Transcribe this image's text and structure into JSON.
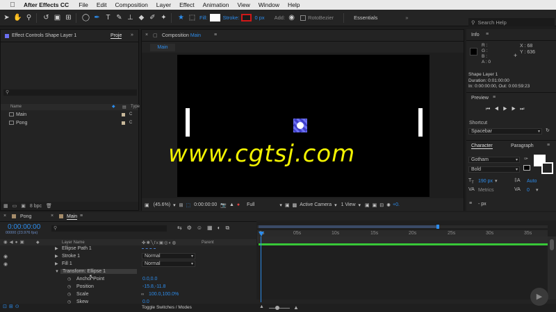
{
  "menubar": {
    "app": "After Effects CC",
    "items": [
      "File",
      "Edit",
      "Composition",
      "Layer",
      "Effect",
      "Animation",
      "View",
      "Window",
      "Help"
    ]
  },
  "toolbar": {
    "fill_label": "Fill:",
    "stroke_label": "Stroke:",
    "stroke_px": "0 px",
    "add_label": "Add:",
    "rotobezier_label": "RotoBezier",
    "workspace": "Essentials",
    "search_placeholder": "Search Help"
  },
  "project": {
    "tab_effect": "Effect Controls Shape Layer 1",
    "tab_project": "Proje",
    "col_name": "Name",
    "col_type": "Type",
    "items": [
      {
        "name": "Main",
        "type": "C"
      },
      {
        "name": "Pong",
        "type": "C"
      }
    ],
    "bpc": "8 bpc"
  },
  "composition": {
    "tab_prefix": "Composition",
    "tab_name": "Main",
    "subtab": "Main",
    "zoom": "(45.6%)",
    "timecode": "0:00:00:00",
    "resolution": "Full",
    "camera": "Active Camera",
    "view": "1 View",
    "exposure": "+0."
  },
  "info": {
    "title": "Info",
    "r": "R :",
    "g": "G :",
    "b": "B :",
    "a": "A : 0",
    "x": "X : 68",
    "y": "Y : 636",
    "layer": "Shape Layer 1",
    "duration": "Duration: 0:01:00:00",
    "in_out": "In: 0:00:00:00, Out: 0:00:59:23"
  },
  "preview": {
    "title": "Preview",
    "shortcut_label": "Shortcut",
    "shortcut_value": "Spacebar"
  },
  "character": {
    "tab_character": "Character",
    "tab_paragraph": "Paragraph",
    "font": "Gotham",
    "style": "Bold",
    "size": "190 px",
    "leading": "Auto",
    "kerning": "Metrics",
    "tracking": "0",
    "unit": "- px"
  },
  "timeline": {
    "tab_pong": "Pong",
    "tab_main": "Main",
    "timecode": "0:00:00:00",
    "fps": "00000 (23.976 fps)",
    "col_layer_name": "Layer Name",
    "col_parent": "Parent",
    "rows": [
      {
        "label": "Ellipse Path 1",
        "mode": ""
      },
      {
        "label": "Stroke 1",
        "mode": "Normal"
      },
      {
        "label": "Fill 1",
        "mode": "Normal"
      },
      {
        "label": "Transform: Ellipse 1",
        "mode": ""
      },
      {
        "label": "Anchor Point",
        "value": "0.0,0.0"
      },
      {
        "label": "Position",
        "value": "-15.8,-11.8"
      },
      {
        "label": "Scale",
        "value": "100.0,100.0%"
      },
      {
        "label": "Skew",
        "value": "0.0"
      }
    ],
    "ruler": [
      "0s",
      "05s",
      "10s",
      "15s",
      "20s",
      "25s",
      "30s",
      "35s"
    ],
    "toggle": "Toggle Switches / Modes"
  },
  "watermark": "www.cgtsj.com"
}
